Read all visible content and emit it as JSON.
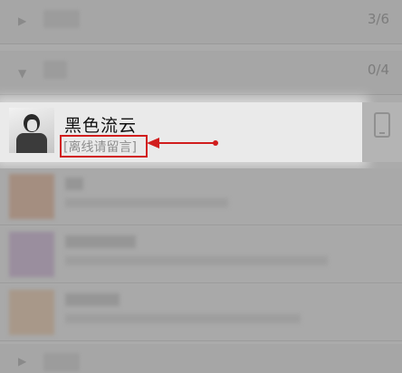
{
  "groups": [
    {
      "label": "",
      "count": "3/6",
      "expanded": false
    },
    {
      "label": "",
      "count": "0/4",
      "expanded": true
    }
  ],
  "highlighted_contact": {
    "name": "黑色流云",
    "status": "[离线请留言]"
  },
  "annotation": {
    "color": "#d11d1d"
  },
  "icons": {
    "collapsed": "triangle-right",
    "expanded": "triangle-down",
    "device": "phone-icon"
  }
}
